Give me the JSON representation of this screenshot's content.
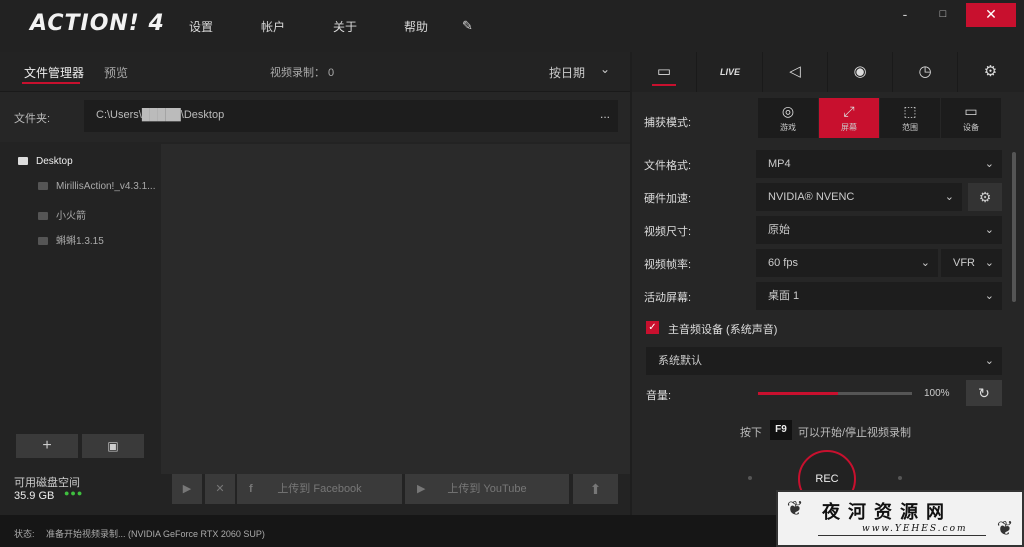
{
  "titlebar": {
    "logo": "ACTION! 4",
    "menu": [
      "设置",
      "帐户",
      "关于",
      "帮助"
    ],
    "minimize": "-",
    "maximize": "□",
    "close": "✕"
  },
  "left": {
    "tab_file_manager": "文件管理器",
    "tab_preview": "预览",
    "recordings": "视频录制：  0",
    "sort": "按日期",
    "folder_label": "文件夹:",
    "folder_path": "C:\\Users\\█████\\Desktop",
    "folder_more": "...",
    "tree": [
      "Desktop",
      "MirillisAction!_v4.3.1...",
      "小火箭",
      "蝌蝌1.3.15"
    ],
    "add_button": "+",
    "disk_label": "可用磁盘空间",
    "disk_size": "35.9 GB",
    "disk_dots": "●●●",
    "actions": {
      "play": "▶",
      "delete": "✕",
      "facebook_icon": "f",
      "facebook": "上传到 Facebook",
      "youtube_icon": "▶",
      "youtube": "上传到 YouTube",
      "upload": "⬆"
    }
  },
  "status": {
    "label": "状态:",
    "text": "准备开始视频录制...   (NVIDIA GeForce RTX 2060 SUP)"
  },
  "right": {
    "tabs": [
      {
        "name": "video",
        "icon": "▭"
      },
      {
        "name": "live",
        "icon": "LIVE"
      },
      {
        "name": "audio",
        "icon": "◁"
      },
      {
        "name": "screenshot",
        "icon": "◉"
      },
      {
        "name": "timer",
        "icon": "◷"
      },
      {
        "name": "settings",
        "icon": "⚙"
      }
    ],
    "capture_label": "捕获模式:",
    "capture_modes": [
      {
        "label": "游戏",
        "icon": "◎"
      },
      {
        "label": "屏幕",
        "icon": "⤢"
      },
      {
        "label": "范围",
        "icon": "⬚"
      },
      {
        "label": "设备",
        "icon": "▭"
      }
    ],
    "settings": {
      "file_format_label": "文件格式:",
      "file_format": "MP4",
      "hw_accel_label": "硬件加速:",
      "hw_accel": "NVIDIA® NVENC",
      "video_size_label": "视频尺寸:",
      "video_size": "原始",
      "frame_rate_label": "视频帧率:",
      "frame_rate": "60 fps",
      "frame_mode": "VFR",
      "active_screen_label": "活动屏幕:",
      "active_screen": "桌面 1"
    },
    "audio": {
      "check": "✓",
      "label": "主音频设备 (系统声音)",
      "device": "系统默认",
      "volume_label": "音量:",
      "volume_pct": "100%",
      "volume_value": 0.52
    },
    "hotkey": {
      "pre": "按下",
      "key": "F9",
      "post": "可以开始/停止视频录制"
    },
    "rec": "REC"
  },
  "watermark": {
    "text": "夜河资源网",
    "url": "www.YEHES.com"
  },
  "colors": {
    "accent": "#c8102e",
    "background": "#1e1e1e",
    "panel": "#262626"
  }
}
